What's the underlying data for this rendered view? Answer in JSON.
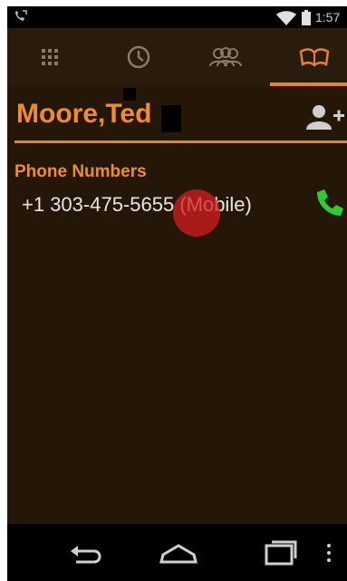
{
  "status_bar": {
    "time": "1:57",
    "icons": [
      "voicemail-icon",
      "wifi-icon",
      "battery-icon"
    ]
  },
  "tabs": [
    {
      "name": "dialpad",
      "icon": "dialpad-icon"
    },
    {
      "name": "recent",
      "icon": "clock-icon"
    },
    {
      "name": "groups",
      "icon": "group-icon"
    },
    {
      "name": "contacts",
      "icon": "address-book-icon",
      "selected": true
    }
  ],
  "contact": {
    "name": "Moore,Ted"
  },
  "phone_section": {
    "title": "Phone Numbers",
    "numbers": [
      {
        "number_text": "+1 303-475-5655 (Mobile)"
      }
    ]
  },
  "nav": {
    "icons": [
      "back-icon",
      "home-icon",
      "recent-apps-icon",
      "menu-icon"
    ]
  },
  "colors": {
    "accent": "#e8832a",
    "name_text": "#f08c2c",
    "content_background": "#241708",
    "tab_background": "#2a1c0d",
    "call_icon": "#2ecc2e",
    "tap_indicator": "#d61e1e"
  }
}
